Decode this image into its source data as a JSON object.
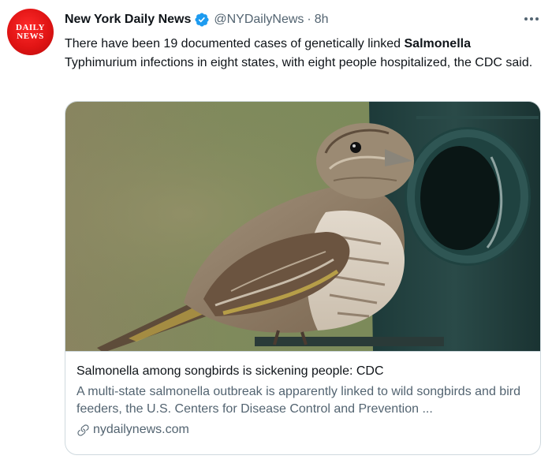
{
  "tweet": {
    "avatar_text_line1": "DAILY",
    "avatar_text_line2": "NEWS",
    "display_name": "New York Daily News",
    "handle": "@NYDailyNews",
    "separator": "·",
    "timestamp": "8h",
    "text_before": "There have been 19 documented cases of genetically linked ",
    "text_bold": "Salmonella",
    "text_after": " Typhimurium infections in eight states, with eight people hospitalized, the CDC said."
  },
  "card": {
    "title": "Salmonella among songbirds is sickening people: CDC",
    "description": "A multi-state salmonella outbreak is apparently linked to wild songbirds and bird feeders, the U.S. Centers for Disease Control and Prevention ...",
    "domain": "nydailynews.com"
  },
  "colors": {
    "verified_blue": "#1d9bf0",
    "brand_red": "#e01414"
  }
}
